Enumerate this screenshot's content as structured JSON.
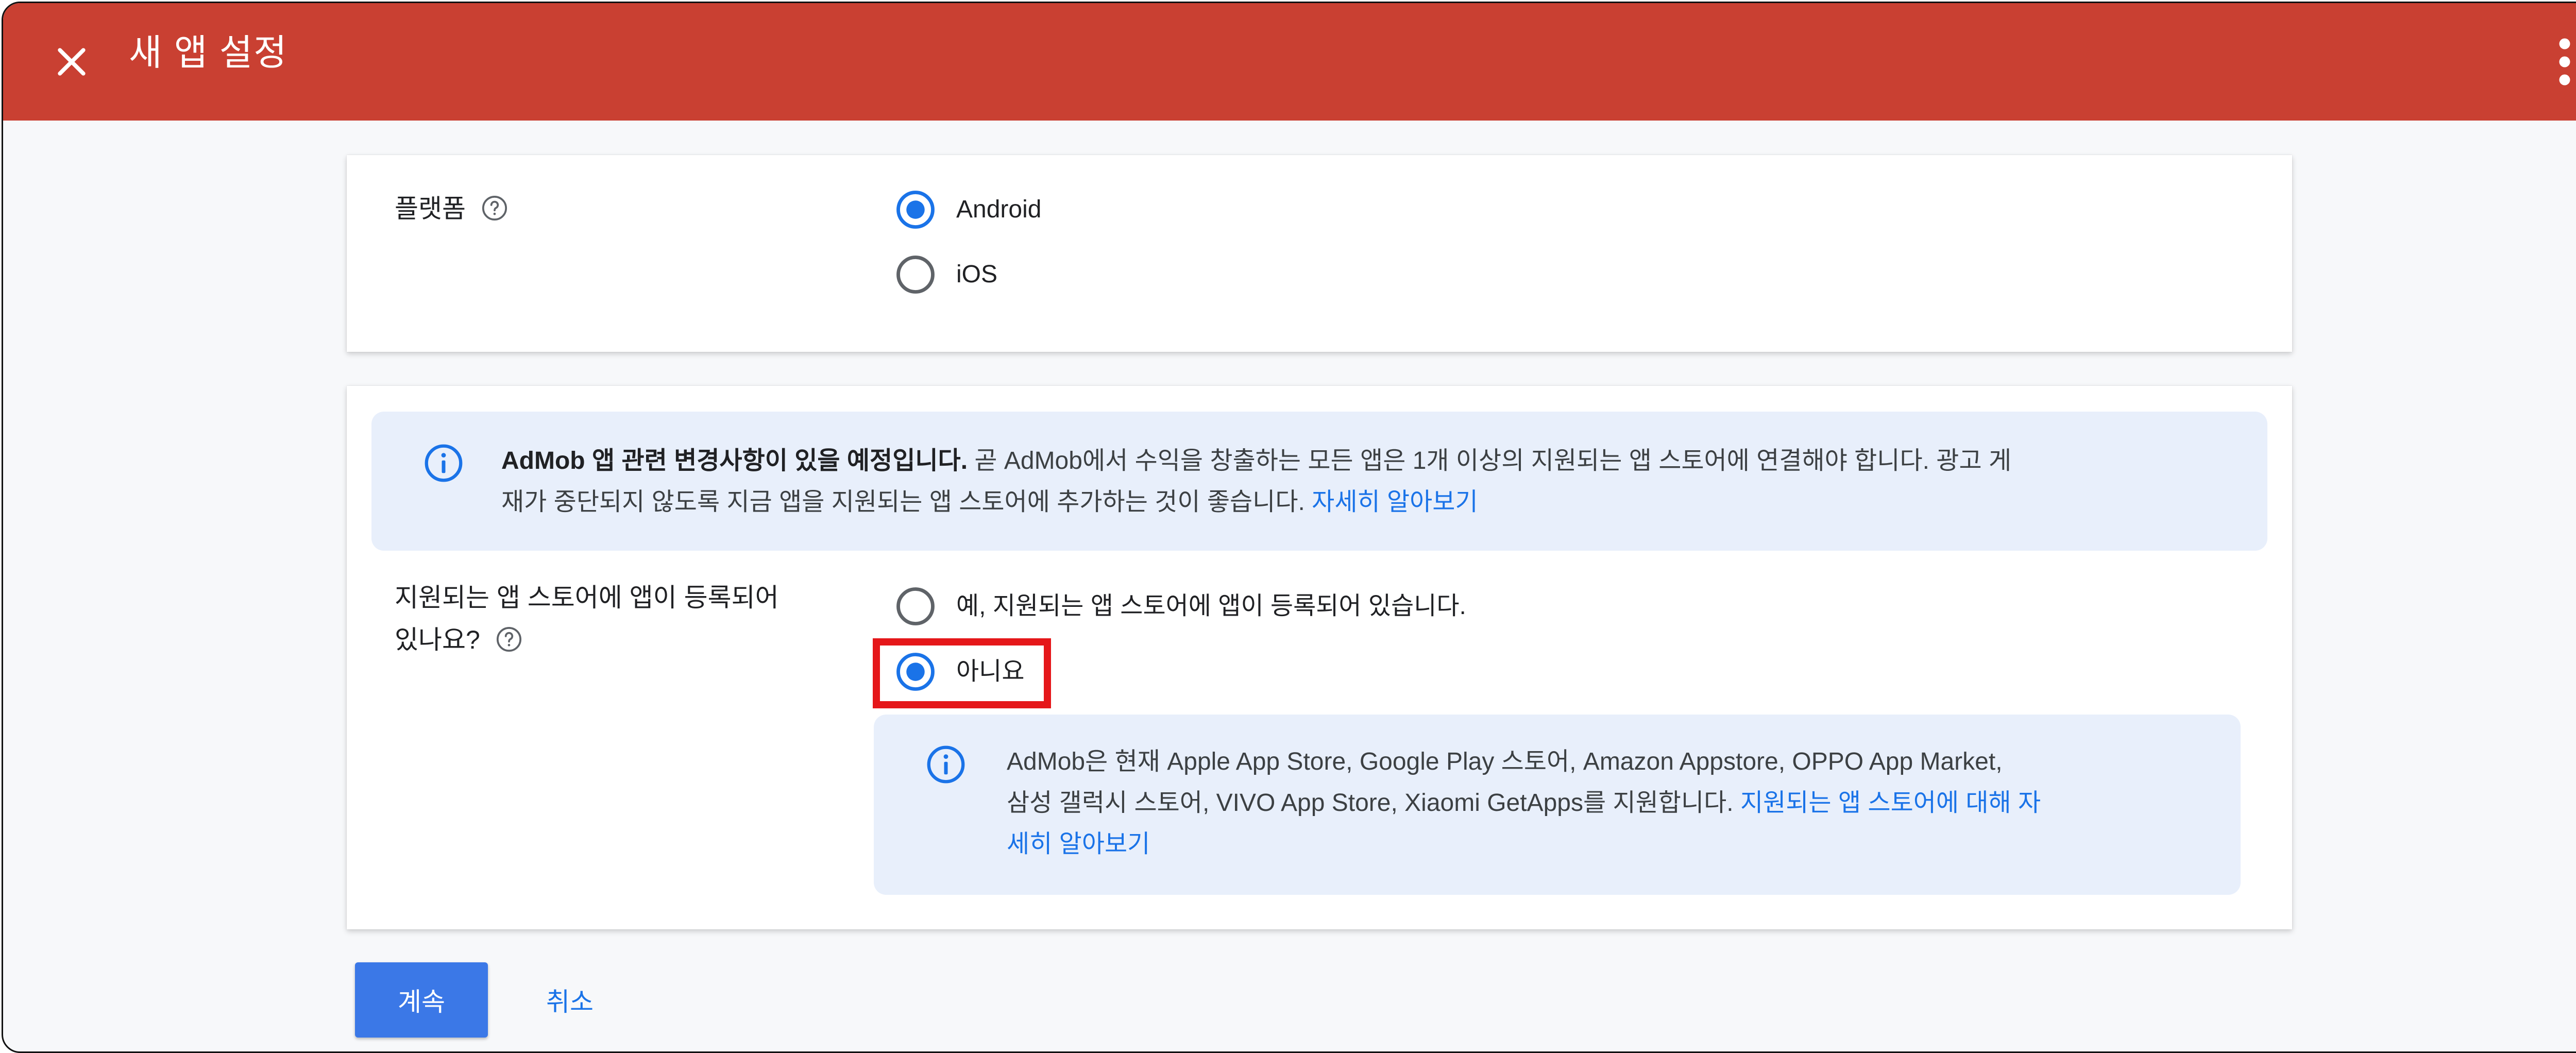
{
  "header": {
    "title": "새 앱 설정",
    "background_color": "#c94032",
    "close_icon": "close-icon",
    "menu_icon": "more-vert-icon"
  },
  "platform_section": {
    "label": "플랫폼",
    "help_icon": "help-circle-icon",
    "options": [
      {
        "label": "Android",
        "selected": true
      },
      {
        "label": "iOS",
        "selected": false
      }
    ]
  },
  "notice": {
    "icon": "info-icon",
    "bold_text": "AdMob 앱 관련 변경사항이 있을 예정입니다.",
    "line1_rest": " 곧 AdMob에서 수익을 창출하는 모든 앱은 1개 이상의 지원되는 앱 스토어에 연결해야 합니다. 광고 게",
    "line2": "재가 중단되지 않도록 지금 앱을 지원되는 앱 스토어에 추가하는 것이 좋습니다. ",
    "link": "자세히 알아보기"
  },
  "store_question": {
    "label_line1": "지원되는 앱 스토어에 앱이 등록되어",
    "label_line2": "있나요?",
    "help_icon": "help-circle-icon",
    "options": [
      {
        "label": "예, 지원되는 앱 스토어에 앱이 등록되어 있습니다.",
        "selected": false
      },
      {
        "label": "아니요",
        "selected": true
      }
    ]
  },
  "store_info": {
    "icon": "info-icon",
    "line1": "AdMob은 현재 Apple App Store, Google Play 스토어, Amazon Appstore, OPPO App Market,",
    "line2": "삼성 갤럭시 스토어, VIVO App Store, Xiaomi GetApps를 지원합니다. ",
    "link_line2": "지원되는 앱 스토어에 대해 자",
    "link_line3": "세히 알아보기"
  },
  "actions": {
    "continue_label": "계속",
    "cancel_label": "취소"
  },
  "colors": {
    "accent": "#1a73e8",
    "primary_button": "#3b78e7",
    "info_background": "#e8effb",
    "highlight": "#e5171a"
  }
}
